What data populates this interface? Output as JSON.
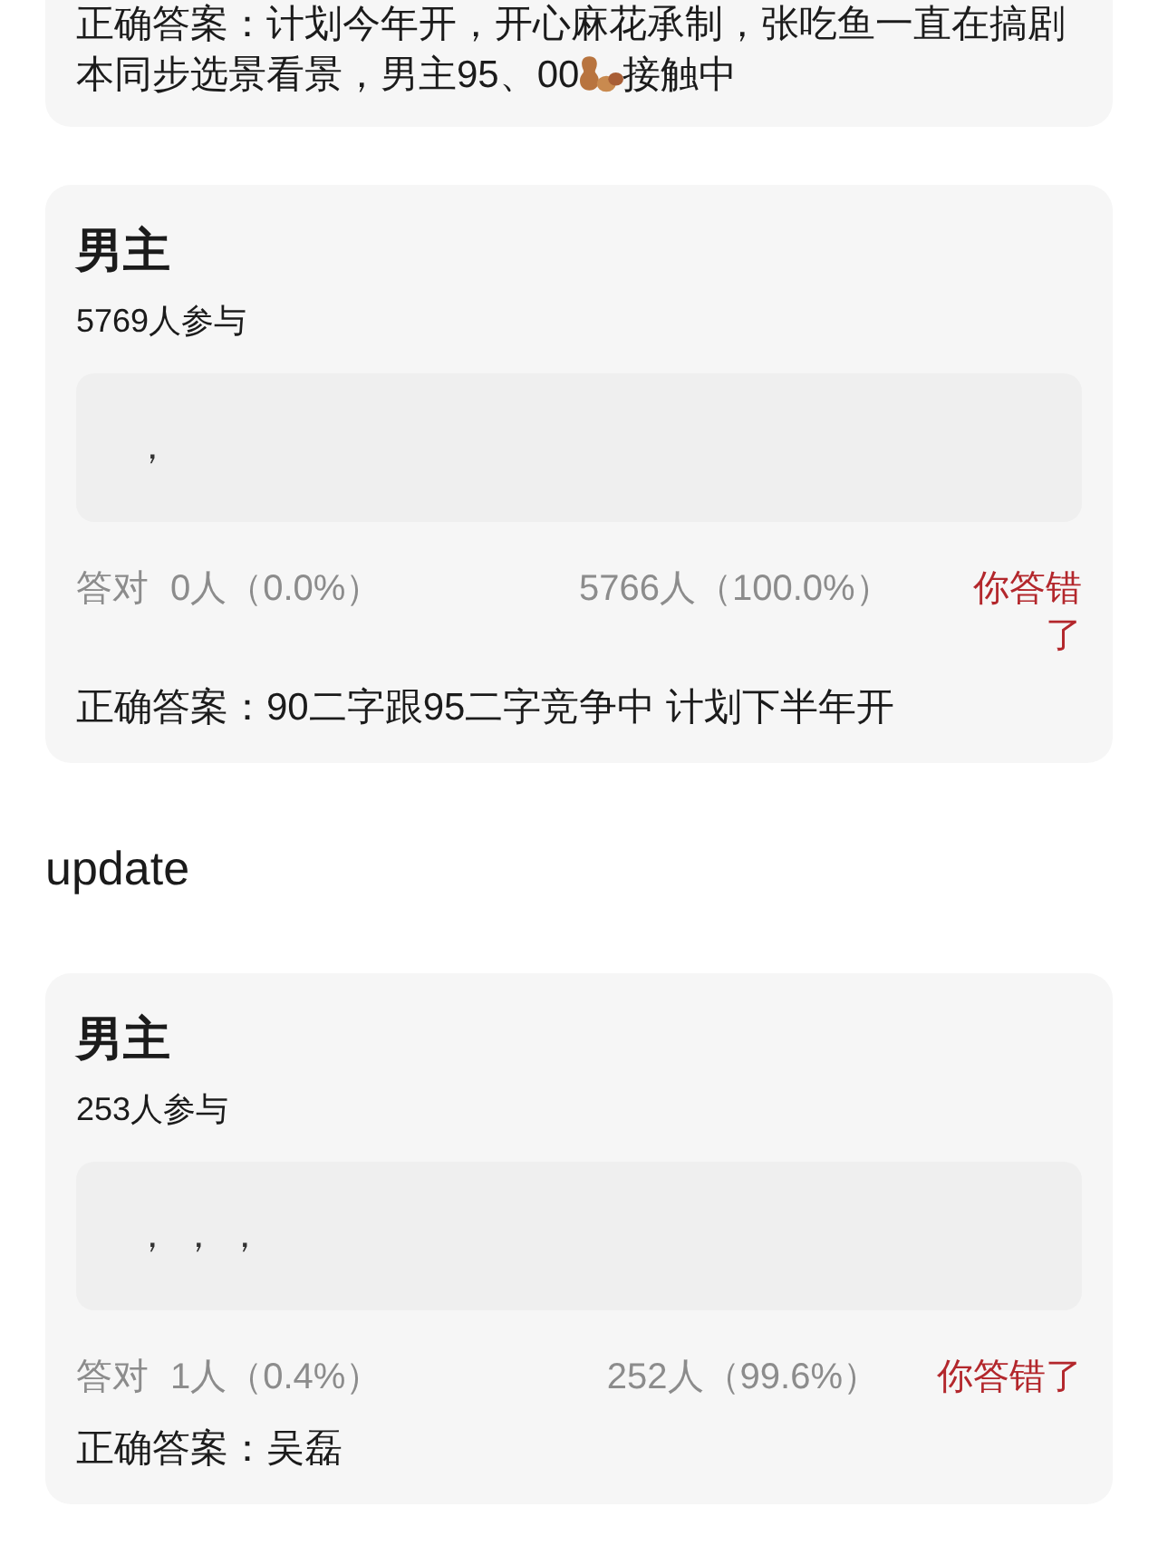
{
  "feed": [
    {
      "kind": "card",
      "answer": [
        {
          "kind": "text",
          "text": "正确答案：计划今年开，开心麻花承制，张吃鱼一直在搞剧本同步选景看景，男主95、00"
        },
        {
          "kind": "emoji"
        },
        {
          "kind": "text",
          "text": "接触中"
        }
      ]
    },
    {
      "kind": "card",
      "title": "男主",
      "participants": "5769人参与",
      "option_text": "，",
      "correct_label": "答对",
      "correct_count": "0人（0.0%）",
      "wrong_count": "5766人（100.0%）",
      "result": "你答错了",
      "answer": [
        {
          "kind": "text",
          "text": "正确答案：90二字跟95二字竞争中 计划下半年开"
        }
      ]
    },
    {
      "kind": "heading",
      "text": "update"
    },
    {
      "kind": "card",
      "title": "男主",
      "participants": "253人参与",
      "option_text": "， ， ，",
      "correct_label": "答对",
      "correct_count": "1人（0.4%）",
      "wrong_count": "252人（99.6%）",
      "result": "你答错了",
      "answer": [
        {
          "kind": "text",
          "text": "正确答案：吴磊"
        }
      ]
    }
  ]
}
